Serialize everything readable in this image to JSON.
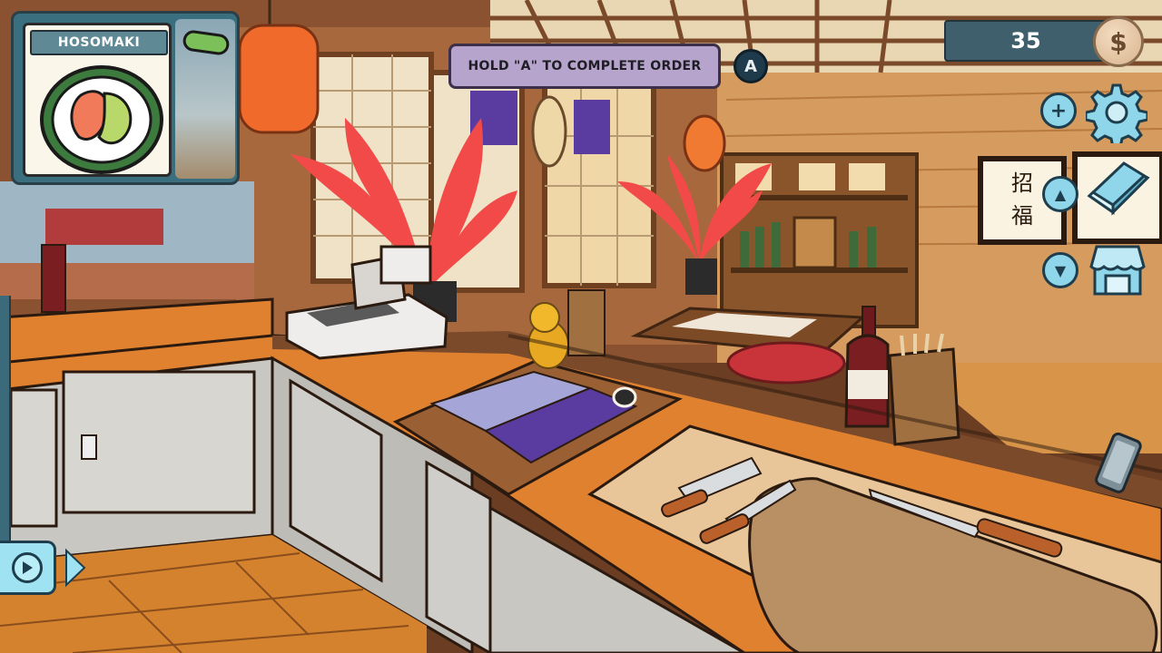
{
  "order": {
    "title": "HOSOMAKI"
  },
  "prompt": {
    "text": "HOLD \"A\" TO COMPLETE ORDER",
    "button_glyph": "A"
  },
  "money": {
    "amount": "35",
    "currency_symbol": "$"
  },
  "controls": {
    "plus_glyph": "+",
    "up_glyph": "▲",
    "down_glyph": "▼",
    "icons": [
      "settings-gear-icon",
      "recipe-book-icon",
      "shop-stall-icon",
      "phone-icon",
      "play-icon"
    ]
  },
  "scene": {
    "wall_signs": [
      "招",
      "福"
    ],
    "colors": {
      "counter_top": "#e0812f",
      "counter_front": "#c9c7c2",
      "floor": "#d4822e",
      "wall": "#d69b5e",
      "plant": "#f24a48",
      "ui_accent": "#8fd6ea"
    }
  }
}
